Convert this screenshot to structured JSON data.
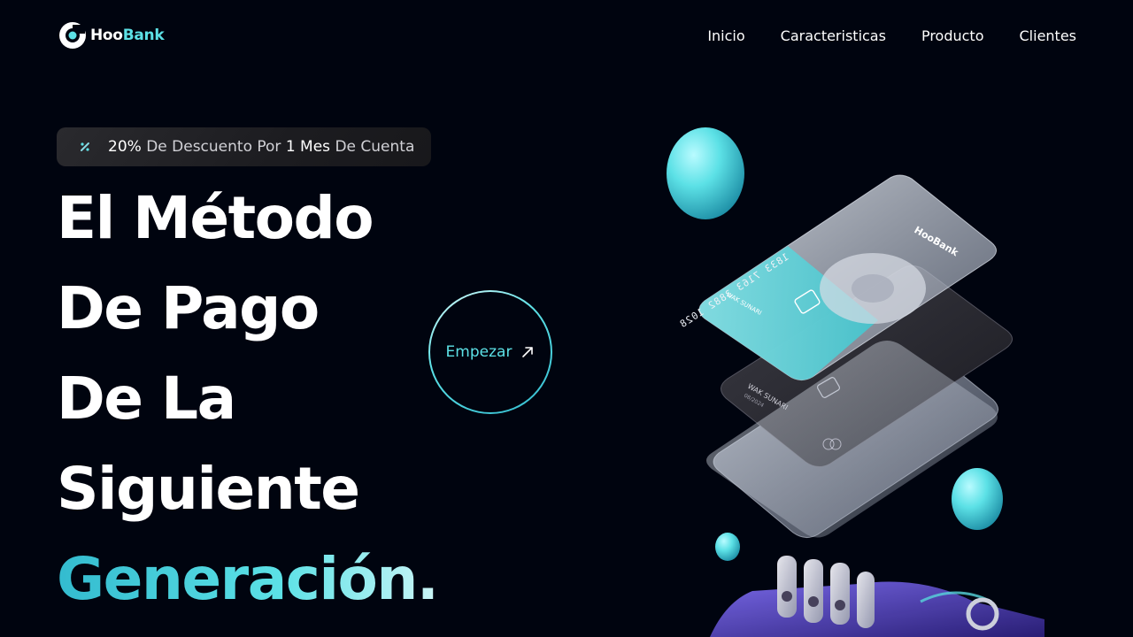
{
  "brand": {
    "hoo": "Hoo",
    "bank": "Bank",
    "accent": "#5ce1e6",
    "background": "#00040f"
  },
  "nav": {
    "items": [
      "Inicio",
      "Caracteristicas",
      "Producto",
      "Clientes"
    ]
  },
  "badge": {
    "icon": "discount-icon",
    "parts": [
      "20%",
      " De Descuento Por ",
      "1",
      " Mes",
      " De Cuenta"
    ]
  },
  "hero": {
    "lines": [
      "El Método",
      "De Pago",
      "De La",
      "Siguiente"
    ],
    "highlight": "Generación."
  },
  "cta": {
    "label": "Empezar",
    "icon": "arrow-up-right-icon"
  },
  "card": {
    "number": "1833 7163 3882 1028",
    "holder": "WAK SUNARI",
    "expiry": "08/2024",
    "brand": "HooBank"
  }
}
